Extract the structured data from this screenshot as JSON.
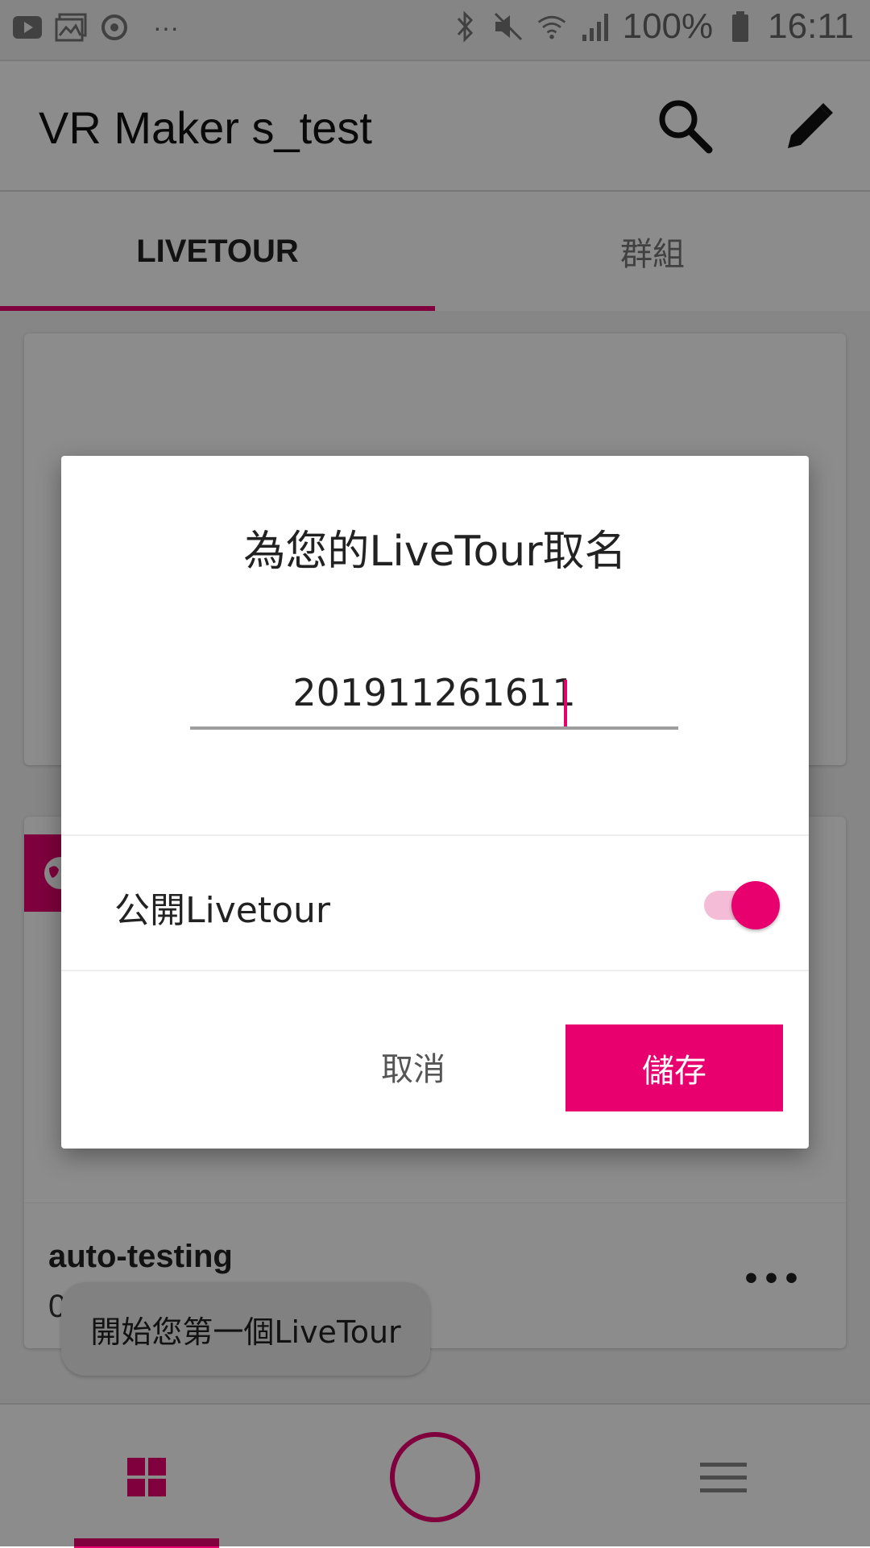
{
  "status_bar": {
    "battery_percent": "100%",
    "time": "16:11",
    "overflow": "···",
    "icons_left": [
      "youtube-icon",
      "gallery-icon",
      "sync-icon"
    ],
    "icons_right": [
      "bluetooth-icon",
      "mute-icon",
      "wifi-icon",
      "signal-icon",
      "battery-icon"
    ]
  },
  "app_bar": {
    "title": "VR Maker s_test",
    "actions": [
      "search-icon",
      "edit-icon"
    ]
  },
  "tabs": [
    {
      "label": "LIVETOUR",
      "selected": true
    },
    {
      "label": "群組",
      "selected": false
    }
  ],
  "cards": [
    {
      "title": "auto-testing",
      "subtitle": "0",
      "more": "•••"
    }
  ],
  "toast": {
    "text": "開始您第一個LiveTour"
  },
  "dialog": {
    "title": "為您的LiveTour取名",
    "name_value": "201911261611",
    "public_label": "公開Livetour",
    "public_enabled": true,
    "cancel_label": "取消",
    "save_label": "儲存"
  },
  "bottom_nav": {
    "items": [
      "grid-icon",
      "capture-icon",
      "menu-icon"
    ],
    "selected": "grid-icon"
  },
  "colors": {
    "accent": "#e8006f",
    "toggle_track": "#f4bcd6"
  }
}
